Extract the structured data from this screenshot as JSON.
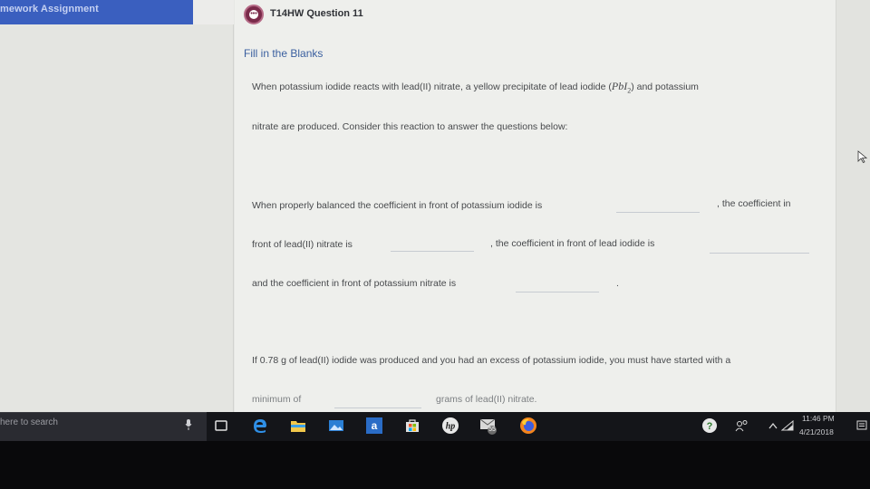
{
  "sidebar": {
    "header": "mework Assignment"
  },
  "question": {
    "title": "T14HW Question 11",
    "section": "Fill in the Blanks",
    "intro_1": "When potassium iodide reacts with lead(II) nitrate, a yellow precipitate of lead iodide (",
    "formula": "PbI",
    "formula_sub": "2",
    "intro_2": ") and potassium",
    "intro_3": "nitrate are produced. Consider this reaction to answer the questions below:",
    "p1_a": "When properly balanced the coefficient in front of potassium iodide is",
    "p1_b": ", the coefficient in",
    "p2_a": "front of lead(II) nitrate is",
    "p2_b": ", the coefficient in front of lead iodide is",
    "p3_a": "and the coefficient in front of potassium nitrate is",
    "p3_b": ".",
    "p4": "If 0.78 g of lead(II) iodide was produced and you had an excess of potassium iodide, you must have started with a",
    "p5_a": "minimum of",
    "p5_b": "grams of lead(II) nitrate."
  },
  "taskbar": {
    "search_placeholder": "here to search",
    "mail_badge": "55",
    "time": "11:46 PM",
    "date": "4/21/2018"
  },
  "colors": {
    "header_blue": "#3a5fbf",
    "badge": "#7a2a4a",
    "section_title": "#3a5f9f",
    "taskbar": "#141519"
  }
}
